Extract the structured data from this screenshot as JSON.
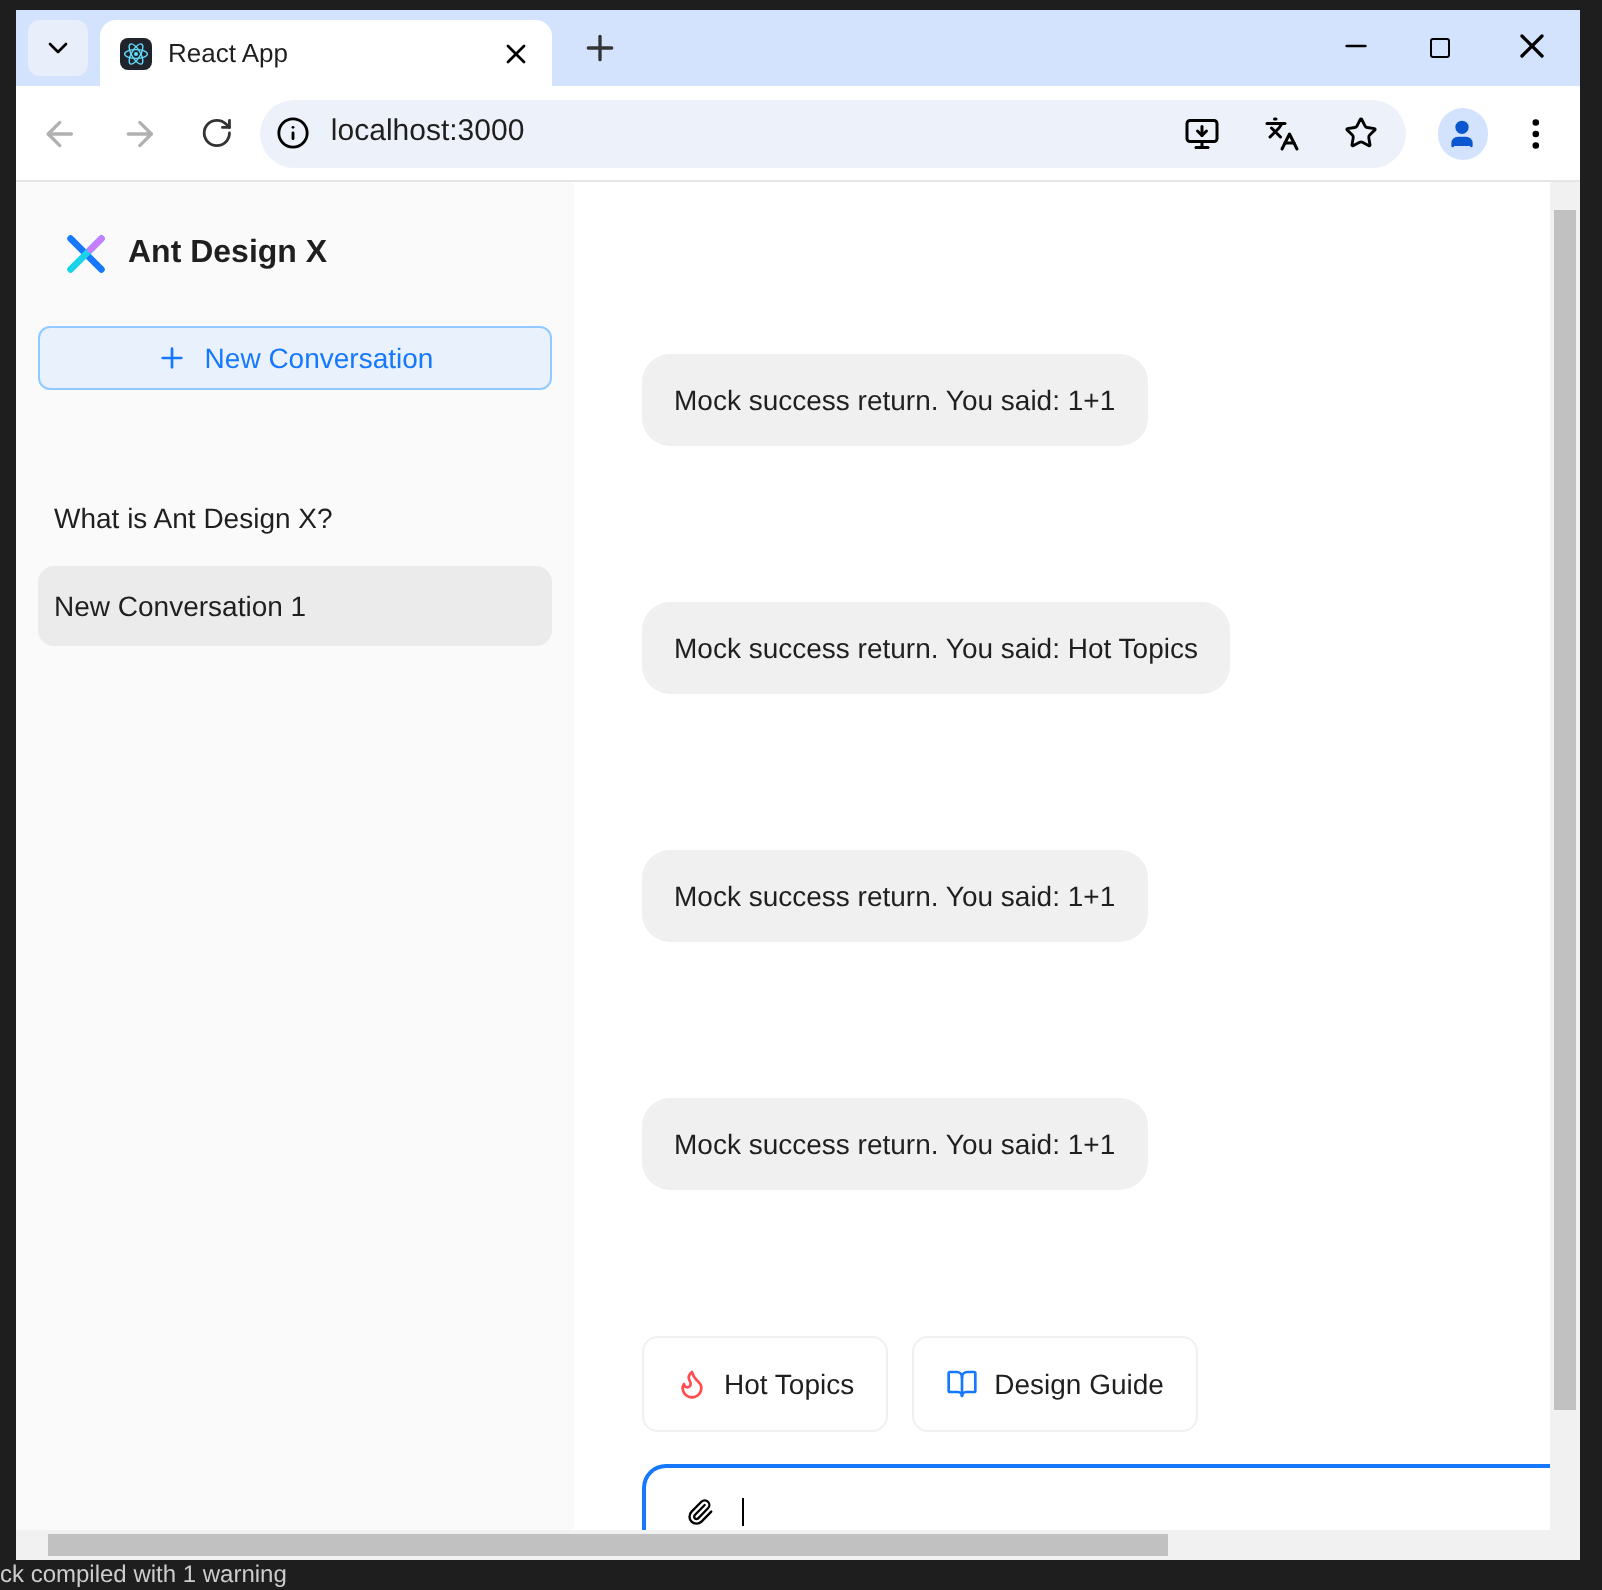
{
  "background_text": {
    "bottom": "ck compiled with 1 warning"
  },
  "browser": {
    "tab_title": "React App",
    "address": "localhost:3000"
  },
  "sidebar": {
    "logo_text": "Ant Design X",
    "new_button": "New Conversation",
    "conversations": [
      {
        "label": "What is Ant Design X?",
        "selected": false
      },
      {
        "label": "New Conversation 1",
        "selected": true
      }
    ]
  },
  "messages": [
    "Mock success return. You said: 1+1",
    "Mock success return. You said: Hot Topics",
    "Mock success return. You said: 1+1",
    "Mock success return. You said: 1+1"
  ],
  "prompts": [
    {
      "kind": "hot",
      "label": "Hot Topics"
    },
    {
      "kind": "guide",
      "label": "Design Guide"
    }
  ]
}
